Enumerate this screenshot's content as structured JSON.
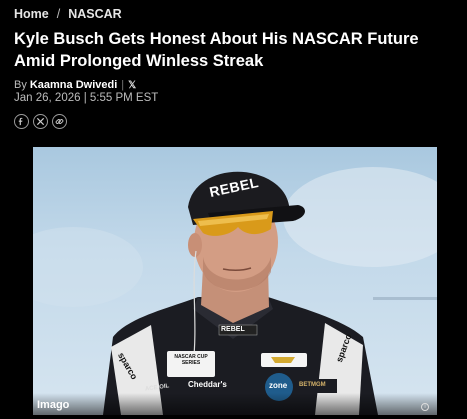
{
  "breadcrumb": {
    "home": "Home",
    "separator": "/",
    "section": "NASCAR"
  },
  "article": {
    "title": "Kyle Busch Gets Honest About His NASCAR Future Amid Prolonged Winless Streak",
    "by_label": "By",
    "author": "Kaamna Dwivedi",
    "x_icon_glyph": "𝕏",
    "date": "Jan 26, 2026 | 5:55 PM EST"
  },
  "share": {
    "icons": [
      "facebook-icon",
      "x-icon",
      "link-icon"
    ]
  },
  "hero": {
    "credit": "Imago",
    "cap_text": "REBEL",
    "jacket_patches": {
      "rebel": "REBEL",
      "sparco": "sparco",
      "nascar": "NASCAR CUP SERIES",
      "cheddars": "Cheddar's",
      "zone": "zone",
      "betmgm": "BETMGM",
      "oil": "ACE OIL"
    }
  },
  "colors": {
    "background": "#000000",
    "text": "#ffffff",
    "muted": "#bcbcbc"
  }
}
